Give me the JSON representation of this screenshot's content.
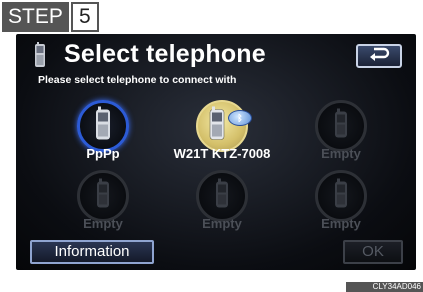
{
  "step": {
    "label": "STEP",
    "number": "5"
  },
  "header": {
    "title": "Select telephone",
    "subtitle": "Please select telephone to connect with",
    "icon": "phone-icon",
    "back_icon": "return-arrow-icon"
  },
  "phones": [
    {
      "label": "PpPp",
      "state": "active"
    },
    {
      "label": "W21T KTZ-7008",
      "state": "selected",
      "badge": "bluetooth-icon"
    },
    {
      "label": "Empty",
      "state": "empty"
    },
    {
      "label": "Empty",
      "state": "empty"
    },
    {
      "label": "Empty",
      "state": "empty"
    },
    {
      "label": "Empty",
      "state": "empty"
    }
  ],
  "footer": {
    "info_label": "Information",
    "ok_label": "OK"
  },
  "image_code": "CLY34AD046",
  "colors": {
    "accent_blue": "#2c5bd6",
    "selected_gold": "#d4c06a",
    "disabled_gray": "#4b4f57"
  }
}
